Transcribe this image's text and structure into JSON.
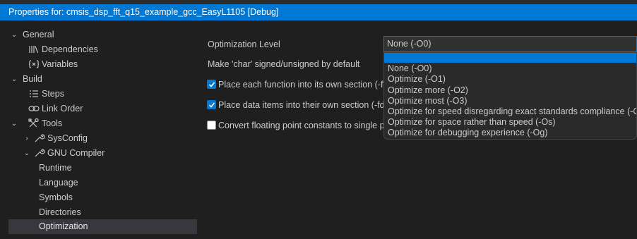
{
  "window": {
    "title": "Properties for: cmsis_dsp_fft_q15_example_gcc_EasyL1105 [Debug]"
  },
  "tree": {
    "items": [
      {
        "label": "General",
        "icon": "chevron-down-icon"
      },
      {
        "label": "Dependencies",
        "icon": "library-icon"
      },
      {
        "label": "Variables",
        "icon": "variable-icon"
      },
      {
        "label": "Build",
        "icon": "chevron-down-icon"
      },
      {
        "label": "Steps",
        "icon": "list-icon"
      },
      {
        "label": "Link Order",
        "icon": "link-icon"
      },
      {
        "label": "Tools",
        "icon": "tools-icon"
      },
      {
        "label": "SysConfig",
        "icon": "wrench-icon"
      },
      {
        "label": "GNU Compiler",
        "icon": "wrench-icon"
      },
      {
        "label": "Runtime"
      },
      {
        "label": "Language"
      },
      {
        "label": "Symbols"
      },
      {
        "label": "Directories"
      },
      {
        "label": "Optimization",
        "selected": true
      }
    ]
  },
  "form": {
    "optimization_label": "Optimization Level",
    "char_label": "Make 'char' signed/unsigned by default",
    "selected_value": "None (-O0)",
    "checks": [
      {
        "label": "Place each function into its own section (-ff",
        "checked": true
      },
      {
        "label": "Place data items into their own section (-fda",
        "checked": true
      },
      {
        "label": "Convert floating point constants to single p",
        "checked": false
      }
    ]
  },
  "dropdown": {
    "options": [
      "",
      "None (-O0)",
      "Optimize (-O1)",
      "Optimize more (-O2)",
      "Optimize most (-O3)",
      "Optimize for speed disregarding exact standards compliance (-Of",
      "Optimize for space rather than speed (-Os)",
      "Optimize for debugging experience (-Og)"
    ]
  },
  "colors": {
    "accent": "#0078d4",
    "background": "#1f1f1f",
    "selection": "#37373d"
  }
}
